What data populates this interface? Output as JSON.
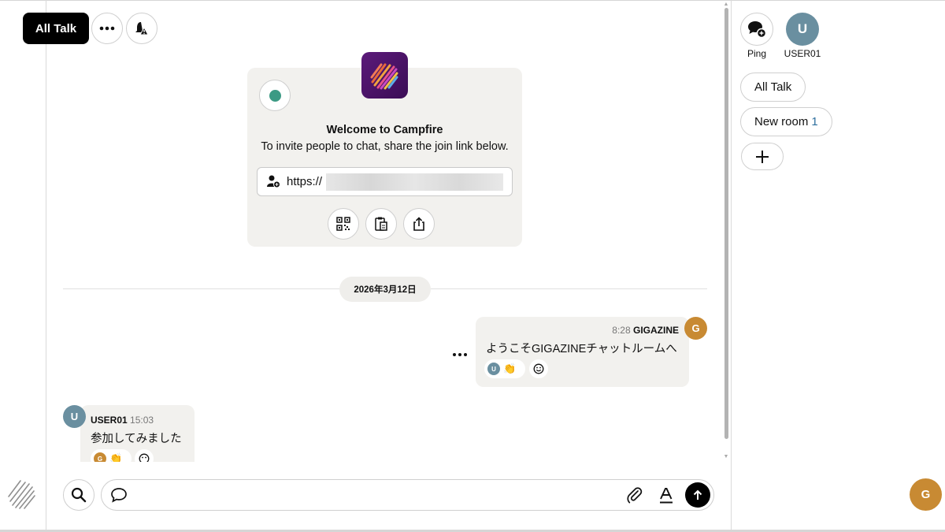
{
  "topbar": {
    "room_button_label": "All Talk",
    "more_icon": "ellipsis-icon",
    "notify_icon": "bell-alert-icon"
  },
  "welcome": {
    "title": "Welcome to Campfire",
    "subtitle": "To invite people to chat, share the join link below.",
    "link_prefix": "https://",
    "actions": [
      "qr-code-icon",
      "copy-clipboard-icon",
      "share-icon"
    ]
  },
  "date_divider": "2026年3月12日",
  "messages": [
    {
      "time": "8:28",
      "author": "GIGAZINE",
      "avatar_initial": "G",
      "avatar_color": "#c88a33",
      "text": "ようこそGIGAZINEチャットルームへ",
      "reaction_avatar": "U",
      "reaction_emoji": "👏",
      "side": "right"
    },
    {
      "time": "15:03",
      "author": "USER01",
      "avatar_initial": "U",
      "avatar_color": "#6a8fa0",
      "text": "参加してみました",
      "reaction_avatar": "G",
      "reaction_emoji": "👏",
      "side": "left"
    }
  ],
  "composer": {
    "placeholder": "",
    "search_icon": "search-icon",
    "chat_icon": "speech-bubble-icon",
    "attach_icon": "paperclip-icon",
    "format_icon": "text-format-icon",
    "send_icon": "arrow-up-icon"
  },
  "sidebar": {
    "ping_label": "Ping",
    "user_label": "USER01",
    "user_initial": "U",
    "user_color": "#6a8fa0",
    "rooms": [
      {
        "name": "All Talk",
        "unread": ""
      },
      {
        "name": "New room",
        "unread": "1"
      }
    ],
    "add_room_icon": "plus-icon"
  },
  "current_user": {
    "initial": "G",
    "color": "#c88a33"
  },
  "colors": {
    "accent_black": "#000000",
    "bubble_bg": "#f2f1ee",
    "online_green": "#3c9a84"
  }
}
